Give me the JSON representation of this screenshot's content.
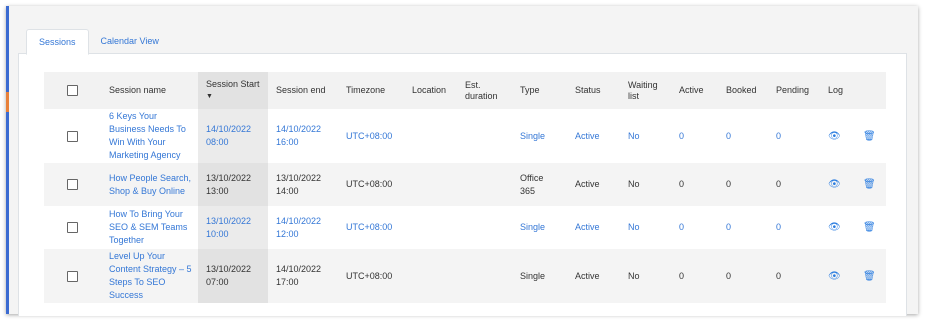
{
  "tabs": [
    {
      "label": "Sessions",
      "active": true
    },
    {
      "label": "Calendar View",
      "active": false
    }
  ],
  "columns": {
    "session_name": "Session name",
    "session_start": "Session Start",
    "sort_indicator": "▼",
    "session_end": "Session end",
    "timezone": "Timezone",
    "location": "Location",
    "est_duration": "Est. duration",
    "type": "Type",
    "status": "Status",
    "waiting_list": "Waiting list",
    "active": "Active",
    "booked": "Booked",
    "pending": "Pending",
    "log": "Log"
  },
  "rows": [
    {
      "name": "6 Keys Your Business Needs To Win With Your Marketing Agency",
      "start": "14/10/2022 08:00",
      "end": "14/10/2022 16:00",
      "timezone": "UTC+08:00",
      "location": "",
      "duration": "",
      "type": "Single",
      "status": "Active",
      "waiting": "No",
      "active": "0",
      "booked": "0",
      "pending": "0",
      "highlight": true
    },
    {
      "name": "How People Search, Shop & Buy Online",
      "start": "13/10/2022 13:00",
      "end": "13/10/2022 14:00",
      "timezone": "UTC+08:00",
      "location": "",
      "duration": "",
      "type": "Office 365",
      "status": "Active",
      "waiting": "No",
      "active": "0",
      "booked": "0",
      "pending": "0",
      "highlight": false
    },
    {
      "name": "How To Bring Your SEO & SEM Teams Together",
      "start": "13/10/2022 10:00",
      "end": "14/10/2022 12:00",
      "timezone": "UTC+08:00",
      "location": "",
      "duration": "",
      "type": "Single",
      "status": "Active",
      "waiting": "No",
      "active": "0",
      "booked": "0",
      "pending": "0",
      "highlight": true
    },
    {
      "name": "Level Up Your Content Strategy – 5 Steps To SEO Success",
      "start": "13/10/2022 07:00",
      "end": "14/10/2022 17:00",
      "timezone": "UTC+08:00",
      "location": "",
      "duration": "",
      "type": "Single",
      "status": "Active",
      "waiting": "No",
      "active": "0",
      "booked": "0",
      "pending": "0",
      "highlight": false
    }
  ],
  "colors": {
    "link": "#3477d6",
    "icon": "#2b7de0",
    "accent": "#3b6bd1"
  }
}
